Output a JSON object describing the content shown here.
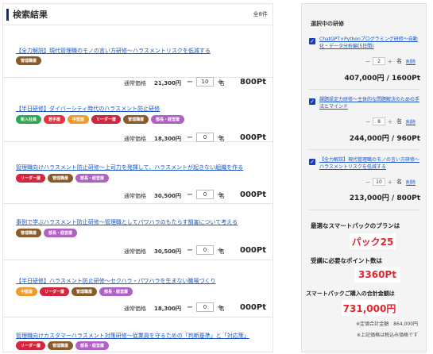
{
  "results": {
    "title": "検索結果",
    "count": "全8件",
    "items": [
      {
        "title": "【全力解説】現代管理職のモノの言い方研修〜ハラスメントリスクを低減する",
        "tags": [
          "管理職層"
        ],
        "price_label": "通常価格",
        "price": "21,300円",
        "qty": "10",
        "unit": "名",
        "points": "800Pt"
      },
      {
        "title": "【半日研修】ダイバーシティ時代のハラスメント防止研修",
        "tags": [
          "新入社員",
          "若手層",
          "中堅層",
          "リーダー層",
          "管理職層",
          "部長・経営層"
        ],
        "price_label": "通常価格",
        "price": "18,300円",
        "qty": "0",
        "unit": "名",
        "points": "000Pt"
      },
      {
        "title": "管理職向けハラスメント防止研修〜上司力を発揮して、ハラスメントが起きない組織を作る",
        "tags": [
          "リーダー層",
          "管理職層",
          "部長・経営層"
        ],
        "price_label": "通常価格",
        "price": "30,500円",
        "qty": "0",
        "unit": "名",
        "points": "000Pt"
      },
      {
        "title": "事例で学ぶハラスメント防止研修〜管理職としてパワハラのもたらす損害について考える",
        "tags": [
          "管理職層",
          "部長・経営層"
        ],
        "price_label": "通常価格",
        "price": "30,500円",
        "qty": "0",
        "unit": "名",
        "points": "000Pt"
      },
      {
        "title": "【半日研修】ハラスメント防止研修〜セクハラ・パワハラを生まない職場づくり",
        "tags": [
          "中堅層",
          "リーダー層",
          "管理職層",
          "部長・経営層"
        ],
        "price_label": "通常価格",
        "price": "18,300円",
        "qty": "0",
        "unit": "名",
        "points": "000Pt"
      },
      {
        "title": "管理職向けカスタマーハラスメント対策研修〜従業員を守るための「判断基準」と「対応策」",
        "tags": [
          "リーダー層",
          "管理職層",
          "部長・経営層"
        ]
      }
    ]
  },
  "selected": {
    "heading": "選択中の研修",
    "items": [
      {
        "title": "ChatGPT×Pythonプログラミング研修〜自動化・データ分析編(5日間)",
        "qty": "2",
        "unit": "名",
        "delete": "削除",
        "price": "407,000円",
        "sep": "/",
        "points": "1600Pt"
      },
      {
        "title": "課題設定力研修〜主体的な問題解決のための手法とマインド",
        "qty": "8",
        "unit": "名",
        "delete": "削除",
        "price": "244,000円",
        "sep": "/",
        "points": "960Pt"
      },
      {
        "title": "【全力解説】現代管理職のモノの言い方研修〜ハラスメントリスクを低減する",
        "qty": "10",
        "unit": "名",
        "delete": "削除",
        "price": "213,000円",
        "sep": "/",
        "points": "800Pt"
      }
    ],
    "plan_label": "最適なスマートパックのプランは",
    "plan_value": "パック25",
    "points_label": "受講に必要なポイント数は",
    "points_value": "3360Pt",
    "total_label": "スマートパックご購入の合計金額は",
    "total_value": "731,000円",
    "regular_total": "※定価合計金額　864,000円",
    "tax_note": "※上記価格は税込み価格です"
  },
  "colors": {
    "accent": "#1a2f5e",
    "link": "#1a56c4",
    "highlight": "#e0262e"
  },
  "tag_classes": {
    "新入社員": "t-shinjin",
    "若手層": "t-wakate",
    "中堅層": "t-chuken",
    "リーダー層": "t-leader",
    "管理職層": "t-kanri",
    "部長・経営層": "t-bucho"
  }
}
